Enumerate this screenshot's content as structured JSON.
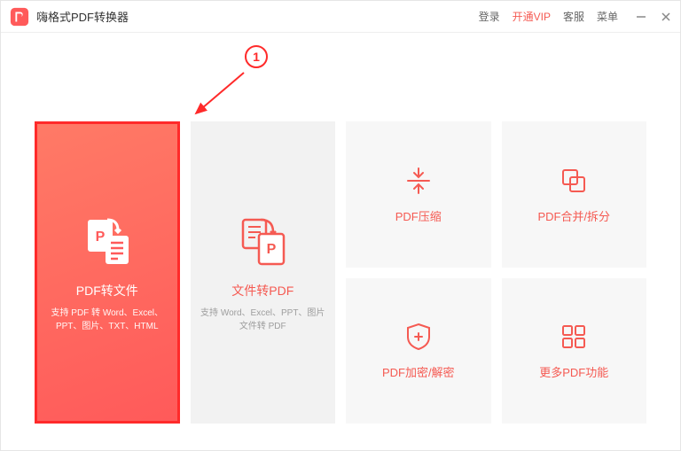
{
  "app": {
    "title": "嗨格式PDF转换器"
  },
  "nav": {
    "login": "登录",
    "vip": "开通VIP",
    "support": "客服",
    "menu": "菜单"
  },
  "cards": {
    "pdf_to_file": {
      "title": "PDF转文件",
      "desc": "支持 PDF 转 Word、Excel、PPT、图片、TXT、HTML"
    },
    "file_to_pdf": {
      "title": "文件转PDF",
      "desc": "支持 Word、Excel、PPT、图片文件转 PDF"
    },
    "compress": {
      "title": "PDF压缩"
    },
    "merge_split": {
      "title": "PDF合并/拆分"
    },
    "encrypt": {
      "title": "PDF加密/解密"
    },
    "more": {
      "title": "更多PDF功能"
    }
  },
  "annotation": {
    "step": "1"
  }
}
